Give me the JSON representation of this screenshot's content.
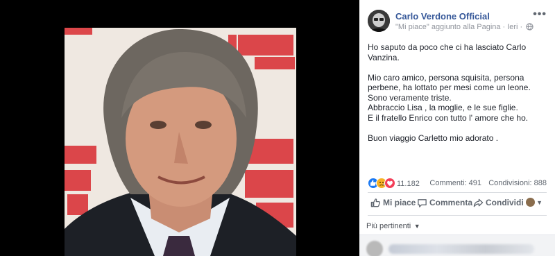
{
  "post": {
    "page_name": "Carlo Verdone Official",
    "subtitle_action": "\"Mi piace\" aggiunto alla Pagina",
    "time": "Ieri",
    "paragraphs": [
      "Ho saputo da poco che ci ha lasciato Carlo Vanzina.",
      "Mio caro amico, persona squisita, persona perbene, ha lottato per mesi come un leone. Sono veramente triste.",
      "Abbraccio Lisa , la moglie, e le sue figlie.",
      "E il fratello Enrico con tutto l' amore che ho.",
      "Buon viaggio Carletto mio adorato ."
    ]
  },
  "stats": {
    "reactions_count": "11.182",
    "comments": "Commenti: 491",
    "shares": "Condivisioni: 888"
  },
  "actions": {
    "like": "Mi piace",
    "comment": "Commenta",
    "share": "Condividi"
  },
  "comments_filter": "Più pertinenti",
  "colors": {
    "link_blue": "#365899",
    "like_blue": "#1877f2",
    "love_red": "#f33e58",
    "sad_yellow": "#f7b125"
  },
  "icons": [
    "more-icon",
    "globe-icon",
    "like-icon",
    "comment-icon",
    "share-icon",
    "chevron-down-icon"
  ]
}
